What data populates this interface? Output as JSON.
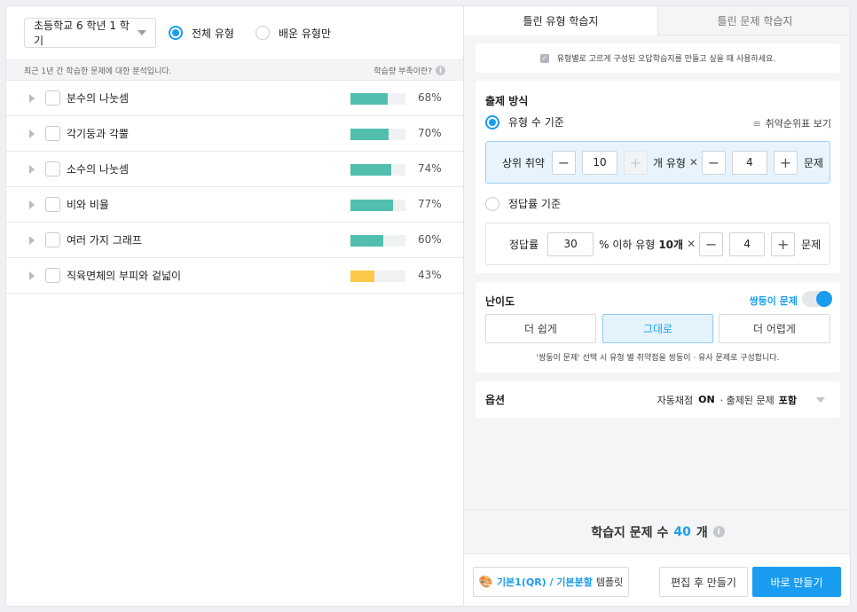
{
  "left": {
    "grade_select": "초등학교 6 학년 1 학기",
    "filter_all": "전체 유형",
    "filter_learned": "배운 유형만",
    "info_text": "최근 1년 간 학습한 문제에 대한 분석입니다.",
    "help_text": "학습량 부족이란?",
    "topics": [
      {
        "label": "분수의 나눗셈",
        "pct": "68%",
        "value": 68,
        "color": "#52bfae"
      },
      {
        "label": "각기둥과 각뿔",
        "pct": "70%",
        "value": 70,
        "color": "#52bfae"
      },
      {
        "label": "소수의 나눗셈",
        "pct": "74%",
        "value": 74,
        "color": "#52bfae"
      },
      {
        "label": "비와 비율",
        "pct": "77%",
        "value": 77,
        "color": "#52bfae"
      },
      {
        "label": "여러 가지 그래프",
        "pct": "60%",
        "value": 60,
        "color": "#52bfae"
      },
      {
        "label": "직육면체의 부피와 겉넓이",
        "pct": "43%",
        "value": 43,
        "color": "#fcc84a"
      }
    ]
  },
  "right": {
    "tab_active": "틀린 유형 학습지",
    "tab_inactive": "틀린 문제 학습지",
    "hint": "유형별로 고르게 구성된 오답학습지를 만들고 싶을 때 사용하세요.",
    "method_title": "출제 방식",
    "by_count_label": "유형 수 기준",
    "rank_link": "취약순위표 보기",
    "top_weak_label": "상위 취약",
    "top_weak_value": "10",
    "type_unit": "개 유형",
    "per_type_value": "4",
    "question_unit": "문제",
    "by_rate_label": "정답률 기준",
    "rate_label": "정답률",
    "rate_value": "30",
    "rate_suffix_pre": "% 이하 유형",
    "rate_suffix_bold": "10개",
    "rate_per_type_value": "4",
    "difficulty_title": "난이도",
    "twin_label": "쌍둥이 문제",
    "diff_easier": "더 쉽게",
    "diff_same": "그대로",
    "diff_harder": "더 어렵게",
    "diff_note": "'쌍둥이 문제' 선택 시 유형 별 취약점을 쌍둥이 · 유사 문제로 구성합니다.",
    "options_title": "옵션",
    "opt_auto": "자동채점",
    "opt_on": "ON",
    "opt_sep": "· 출제된 문제",
    "opt_include": "포함",
    "count_pre": "학습지 문제 수",
    "count_value": "40",
    "count_unit": "개",
    "tpl_a": "기본1(QR) / 기본분할",
    "tpl_b": "템플릿",
    "edit_btn": "편집 후 만들기",
    "make_btn": "바로 만들기"
  },
  "colors": {
    "accent": "#1a9df0",
    "teal_bar": "#52bfae",
    "yellow_bar": "#fcc84a"
  }
}
